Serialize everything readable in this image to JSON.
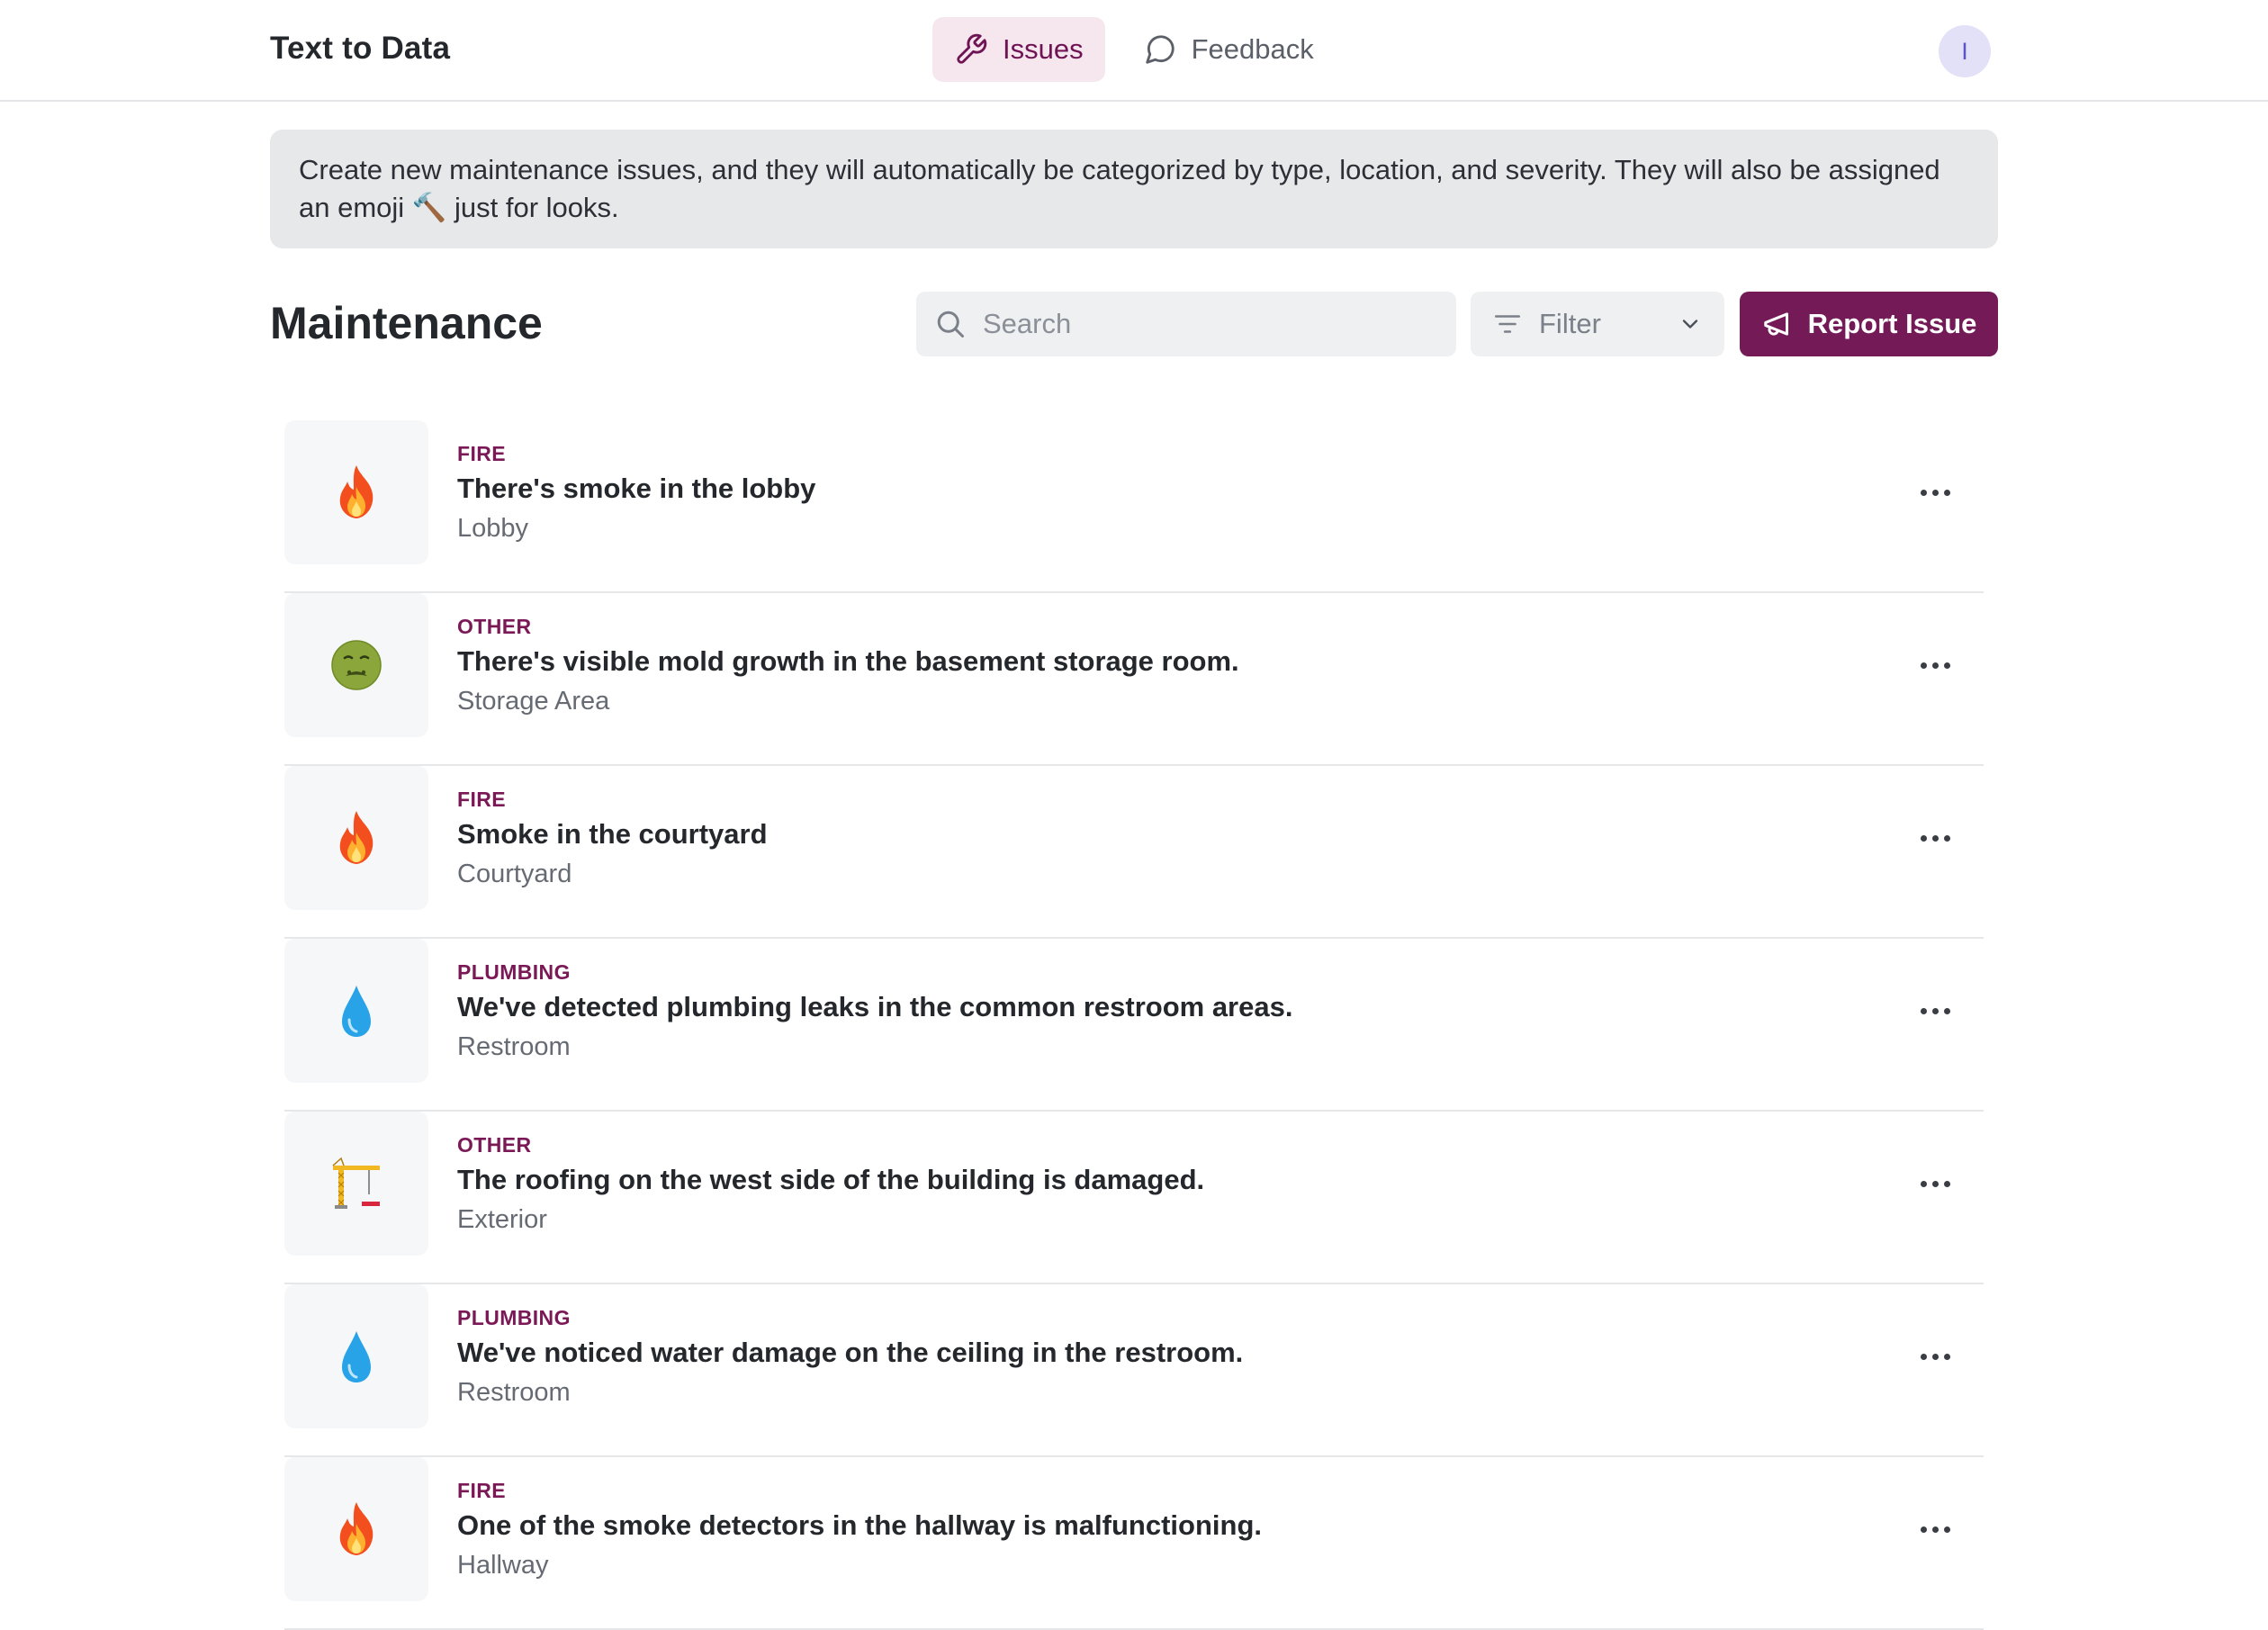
{
  "app": {
    "title": "Text to Data",
    "user_initial": "I"
  },
  "nav": {
    "tabs": [
      {
        "label": "Issues",
        "icon": "wrench-icon",
        "active": true
      },
      {
        "label": "Feedback",
        "icon": "speech-bubble-icon",
        "active": false
      }
    ]
  },
  "banner": {
    "text_before_emoji": "Create new maintenance issues, and they will automatically be categorized by type, location, and severity. They will also be assigned an emoji ",
    "emoji": "🔨",
    "text_after_emoji": " just for looks."
  },
  "page": {
    "title": "Maintenance"
  },
  "toolbar": {
    "search_placeholder": "Search",
    "filter_label": "Filter",
    "report_label": "Report Issue"
  },
  "colors": {
    "accent": "#741a57",
    "accent_light": "#f6e7ef",
    "category_text": "#7b1957",
    "banner_bg": "#e7e8ea"
  },
  "issues": [
    {
      "type": "FIRE",
      "title": "There's smoke in the lobby",
      "location": "Lobby",
      "icon": "fire-icon"
    },
    {
      "type": "OTHER",
      "title": "There's visible mold growth in the basement storage room.",
      "location": "Storage Area",
      "icon": "nauseated-face-icon"
    },
    {
      "type": "FIRE",
      "title": "Smoke in the courtyard",
      "location": "Courtyard",
      "icon": "fire-icon"
    },
    {
      "type": "PLUMBING",
      "title": "We've detected plumbing leaks in the common restroom areas.",
      "location": "Restroom",
      "icon": "droplet-icon"
    },
    {
      "type": "OTHER",
      "title": "The roofing on the west side of the building is damaged.",
      "location": "Exterior",
      "icon": "construction-crane-icon"
    },
    {
      "type": "PLUMBING",
      "title": "We've noticed water damage on the ceiling in the restroom.",
      "location": "Restroom",
      "icon": "droplet-icon"
    },
    {
      "type": "FIRE",
      "title": "One of the smoke detectors in the hallway is malfunctioning.",
      "location": "Hallway",
      "icon": "fire-icon"
    }
  ]
}
